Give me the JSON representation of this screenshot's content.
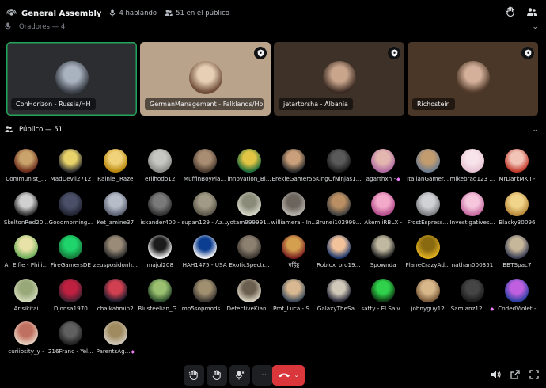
{
  "header": {
    "title": "General Assembly",
    "speaking_text": "4 hablando",
    "audience_text": "51 en el público"
  },
  "speakers_section": {
    "label": "Oradores — 4"
  },
  "speakers": [
    {
      "name": "ConHorizon - Russia/HH",
      "bg": "#2b2d31",
      "active": true,
      "moderator": false,
      "avatar_colors": [
        "#3a3f47",
        "#a9b2bf"
      ]
    },
    {
      "name": "GermanManagement - Falklands/Hol",
      "bg": "#b9a38a",
      "active": false,
      "moderator": true,
      "avatar_colors": [
        "#6e4b36",
        "#e6cfb4"
      ]
    },
    {
      "name": "jetartbrsha - Albania",
      "bg": "#3e3128",
      "active": false,
      "moderator": true,
      "avatar_colors": [
        "#3a2a22",
        "#c9a58c"
      ]
    },
    {
      "name": "Richostein",
      "bg": "#4a3727",
      "active": false,
      "moderator": true,
      "avatar_colors": [
        "#513a2a",
        "#d4b09a"
      ]
    }
  ],
  "audience_section": {
    "label": "Público — 51"
  },
  "audience": [
    {
      "name": "Communist_...",
      "c1": "#6a2b1b",
      "c2": "#c9a36b",
      "boost": false
    },
    {
      "name": "MadDevil2712",
      "c1": "#2c2c2c",
      "c2": "#e8d36a",
      "boost": false
    },
    {
      "name": "Rainiel_Raze",
      "c1": "#b8860b",
      "c2": "#f0d27a",
      "boost": false
    },
    {
      "name": "erlihodo12",
      "c1": "#8a8a86",
      "c2": "#c6c6c2",
      "boost": false
    },
    {
      "name": "MuffinBoyPla...",
      "c1": "#4a3a2e",
      "c2": "#a98d72",
      "boost": false
    },
    {
      "name": "innovation_Bi...",
      "c1": "#1d6a3a",
      "c2": "#e2c544",
      "boost": false
    },
    {
      "name": "ErekleGamer55",
      "c1": "#2a2a2a",
      "c2": "#caa07a",
      "boost": false
    },
    {
      "name": "KingOfNinjas1...",
      "c1": "#1c1c1c",
      "c2": "#5a5a5a",
      "boost": false
    },
    {
      "name": "agarthxn -",
      "c1": "#b06aa0",
      "c2": "#e3b7b0",
      "boost": true
    },
    {
      "name": "ItalianGamer...",
      "c1": "#6d7b8f",
      "c2": "#c29c6e",
      "boost": false
    },
    {
      "name": "mikebrad123 ...",
      "c1": "#e7c3d2",
      "c2": "#f7e3ea",
      "boost": false
    },
    {
      "name": "MrDarkMKII -",
      "c1": "#c0392b",
      "c2": "#f2c4b8",
      "boost": false
    },
    {
      "name": "SkeltonRed20...",
      "c1": "#2b2b2b",
      "c2": "#d0d0d0",
      "boost": false
    },
    {
      "name": "Goodmorning...",
      "c1": "#1f2230",
      "c2": "#4b5068",
      "boost": false
    },
    {
      "name": "Ket_amine37",
      "c1": "#5a6070",
      "c2": "#b6bcc8",
      "boost": false
    },
    {
      "name": "iskander400 -",
      "c1": "#2e2e2e",
      "c2": "#7a7a7a",
      "boost": false
    },
    {
      "name": "supan129 - Az...",
      "c1": "#5a5548",
      "c2": "#a19a86",
      "boost": false
    },
    {
      "name": "yotam999991...",
      "c1": "#d6d6c8",
      "c2": "#8b8b7a",
      "boost": false
    },
    {
      "name": "williamera - In...",
      "c1": "#b7b2ab",
      "c2": "#6b655e",
      "boost": false
    },
    {
      "name": "Brunei102999...",
      "c1": "#3e3e3e",
      "c2": "#b98f63",
      "boost": false
    },
    {
      "name": "AkemiiRBLX -",
      "c1": "#b04a8a",
      "c2": "#f3a9c9",
      "boost": false
    },
    {
      "name": "FrostEspress...",
      "c1": "#7a7c7f",
      "c2": "#cfd1d4",
      "boost": false
    },
    {
      "name": "Investigatives...",
      "c1": "#c66aa0",
      "c2": "#f5c6dc",
      "boost": false
    },
    {
      "name": "Blacky30096",
      "c1": "#b8893a",
      "c2": "#f0d48a",
      "boost": false
    },
    {
      "name": "Al_Elfie - Phili...",
      "c1": "#6fae5a",
      "c2": "#e9e2a8",
      "boost": false
    },
    {
      "name": "FireGamersDE",
      "c1": "#167a3a",
      "c2": "#1fd46b",
      "boost": false
    },
    {
      "name": "zeusposidonh...",
      "c1": "#2a2a2a",
      "c2": "#9a8b78",
      "boost": false
    },
    {
      "name": "majul208",
      "c1": "#f2f2f2",
      "c2": "#1b1b1b",
      "boost": false
    },
    {
      "name": "HAH1475 - USA",
      "c1": "#f4f4f4",
      "c2": "#0b3d91",
      "boost": false
    },
    {
      "name": "ExoticSpectr...",
      "c1": "#3c3630",
      "c2": "#8c8070",
      "boost": false
    },
    {
      "name": "गहिंड्ड",
      "c1": "#7a2020",
      "c2": "#d4a050",
      "boost": false
    },
    {
      "name": "Roblox_pro19...",
      "c1": "#1e3a6e",
      "c2": "#f2c29a",
      "boost": false
    },
    {
      "name": "Spownda",
      "c1": "#202020",
      "c2": "#c0b8a0",
      "boost": false
    },
    {
      "name": "PlaneCrazyAd...",
      "c1": "#e0b020",
      "c2": "#8a6a10",
      "boost": false
    },
    {
      "name": "nathan000351",
      "c1": "#000000",
      "c2": "#000000",
      "boost": false
    },
    {
      "name": "BBTSpac7",
      "c1": "#3a3f55",
      "c2": "#c7b79a",
      "boost": false
    },
    {
      "name": "Arisikitai",
      "c1": "#d0d8b8",
      "c2": "#98a878",
      "boost": false
    },
    {
      "name": "Djonsa1970",
      "c1": "#402030",
      "c2": "#c02040",
      "boost": false
    },
    {
      "name": "chaikahmin2",
      "c1": "#1b1b2b",
      "c2": "#d04050",
      "boost": false
    },
    {
      "name": "Blusteelian_G...",
      "c1": "#2a4a2a",
      "c2": "#9ac070",
      "boost": false
    },
    {
      "name": "mp5sopmods ...",
      "c1": "#3a3530",
      "c2": "#a09070",
      "boost": false
    },
    {
      "name": "DefectiveKian...",
      "c1": "#d8d0c0",
      "c2": "#6b6050",
      "boost": false
    },
    {
      "name": "Prof_Luca - S...",
      "c1": "#3c4a5a",
      "c2": "#d8b890",
      "boost": false
    },
    {
      "name": "GalaxyTheSa...",
      "c1": "#2a2a3a",
      "c2": "#d0c8b8",
      "boost": false
    },
    {
      "name": "satty - El Salv...",
      "c1": "#0f3a14",
      "c2": "#2fd24a",
      "boost": false
    },
    {
      "name": "johnyguy12",
      "c1": "#7a5a3a",
      "c2": "#d8b88a",
      "boost": false
    },
    {
      "name": "Samianz12 ...",
      "c1": "#1b1b1b",
      "c2": "#454545",
      "boost": true
    },
    {
      "name": "CodedViolet -",
      "c1": "#2a40a0",
      "c2": "#c060e0",
      "boost": false
    },
    {
      "name": "curiiosity_y -",
      "c1": "#e8d0c0",
      "c2": "#c07060",
      "boost": false
    },
    {
      "name": "216Franc - Yel...",
      "c1": "#202020",
      "c2": "#606060",
      "boost": false
    },
    {
      "name": "ParentsAg...",
      "c1": "#d0c8b8",
      "c2": "#a08a60",
      "boost": true
    }
  ],
  "colors": {
    "accent_green": "#23a559",
    "end_call": "#da373c",
    "boost_pink": "#f47fff"
  },
  "icons": {
    "header": [
      "voice-channel-icon",
      "microphone-icon",
      "audience-icon",
      "raise-hand-icon",
      "members-icon"
    ],
    "bottom_bar": [
      "hand-wave-icon",
      "raise-hand-icon",
      "request-speak-icon",
      "more-icon",
      "end-call-icon",
      "volume-icon",
      "popout-icon",
      "fullscreen-icon"
    ]
  }
}
